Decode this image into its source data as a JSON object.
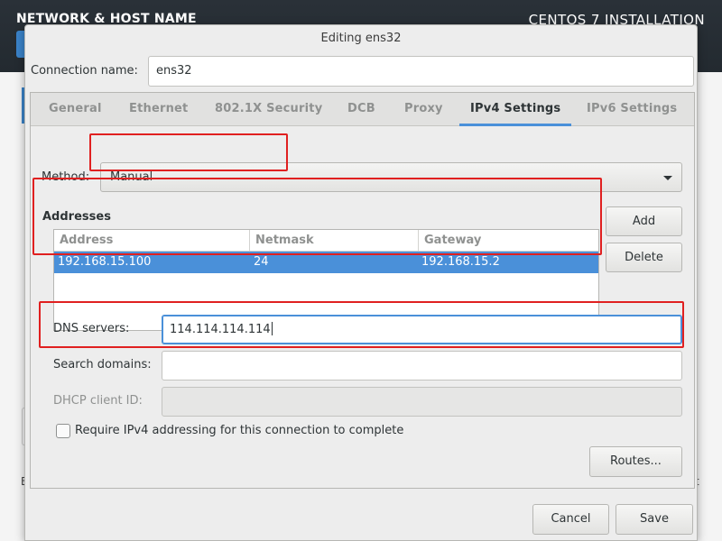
{
  "background": {
    "title_left": "NETWORK & HOST NAME",
    "title_right": "CENTOS 7 INSTALLATION",
    "left_fragment": "E",
    "right_fragment": "t"
  },
  "dialog": {
    "title": "Editing ens32",
    "connection_name_label": "Connection name:",
    "connection_name_value": "ens32",
    "tabs": [
      {
        "label": "General",
        "active": false
      },
      {
        "label": "Ethernet",
        "active": false
      },
      {
        "label": "802.1X Security",
        "active": false
      },
      {
        "label": "DCB",
        "active": false
      },
      {
        "label": "Proxy",
        "active": false
      },
      {
        "label": "IPv4 Settings",
        "active": true
      },
      {
        "label": "IPv6 Settings",
        "active": false
      }
    ],
    "ipv4": {
      "method_label": "Method:",
      "method_value": "Manual",
      "addresses_heading": "Addresses",
      "columns": [
        "Address",
        "Netmask",
        "Gateway"
      ],
      "rows": [
        {
          "address": "192.168.15.100",
          "netmask": "24",
          "gateway": "192.168.15.2",
          "selected": true
        }
      ],
      "add_label": "Add",
      "delete_label": "Delete",
      "dns_label": "DNS servers:",
      "dns_value": "114.114.114.114",
      "search_label": "Search domains:",
      "search_value": "",
      "dhcp_label": "DHCP client ID:",
      "dhcp_value": "",
      "require_label": "Require IPv4 addressing for this connection to complete",
      "require_checked": false,
      "routes_label": "Routes..."
    },
    "cancel_label": "Cancel",
    "save_label": "Save"
  },
  "colors": {
    "accent": "#4a90d9",
    "annotation": "#e02020",
    "header_bg": "#262d33"
  },
  "icons": {
    "method_dropdown": "triangle-down-icon"
  }
}
